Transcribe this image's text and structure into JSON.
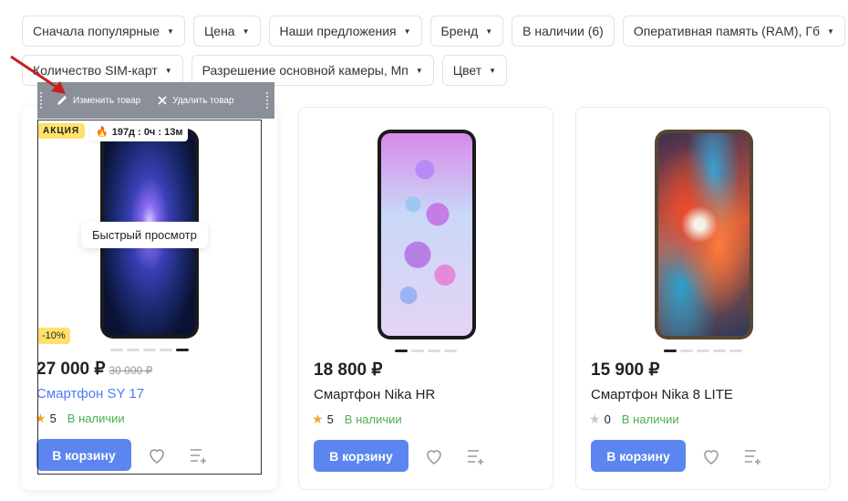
{
  "filters": {
    "row1": [
      {
        "label": "Сначала популярные"
      },
      {
        "label": "Цена"
      },
      {
        "label": "Наши предложения"
      },
      {
        "label": "Бренд"
      },
      {
        "label": "В наличии (6)"
      },
      {
        "label": "Оперативная память (RAM), Гб"
      }
    ],
    "row2": [
      {
        "label": "Количество SIM-карт"
      },
      {
        "label": "Разрешение основной камеры, Мп"
      },
      {
        "label": "Цвет"
      }
    ]
  },
  "toolbar": {
    "edit_label": "Изменить товар",
    "delete_label": "Удалить товар"
  },
  "products": [
    {
      "badge": "АКЦИЯ",
      "timer": "197д : 0ч : 13м",
      "discount": "-10%",
      "quick_view": "Быстрый просмотр",
      "price": "27 000 ₽",
      "old_price": "30 000 ₽",
      "title": "Смартфон SY 17",
      "rating": "5",
      "stock": "В наличии",
      "cart_label": "В корзину"
    },
    {
      "price": "18 800 ₽",
      "title": "Смартфон Nika HR",
      "rating": "5",
      "stock": "В наличии",
      "cart_label": "В корзину"
    },
    {
      "price": "15 900 ₽",
      "title": "Смартфон Nika 8 LITE",
      "rating": "0",
      "stock": "В наличии",
      "cart_label": "В корзину"
    }
  ],
  "colors": {
    "accent": "#5b86f0",
    "link": "#4c7cf3",
    "stock": "#4caf50",
    "sale_badge": "#ffe16b",
    "toolbar": "#8a8f99"
  }
}
